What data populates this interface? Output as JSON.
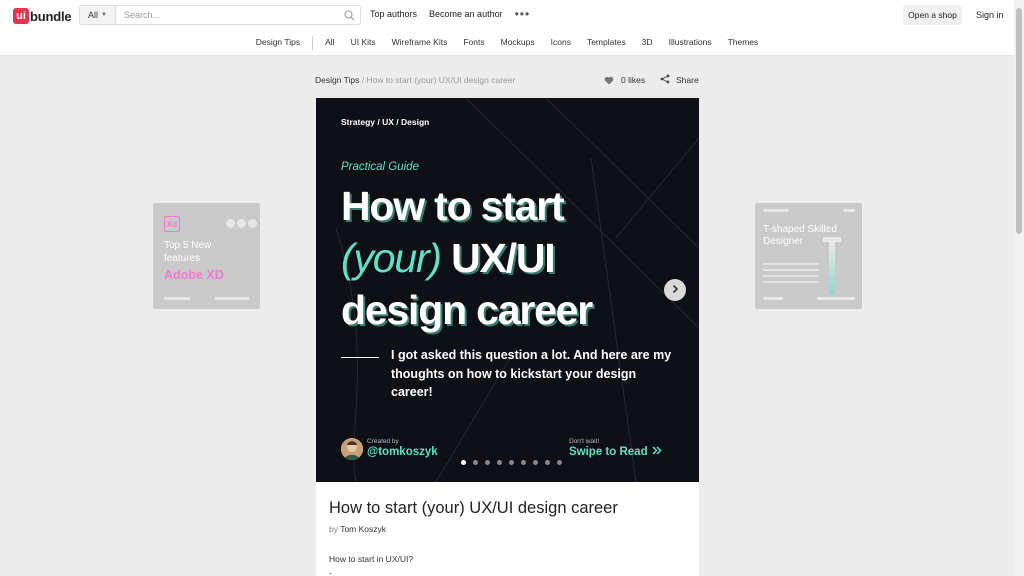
{
  "header": {
    "logo_mark": "ui",
    "logo_text": "bundle",
    "search": {
      "category": "All",
      "placeholder": "Search..."
    },
    "links": [
      "Top authors",
      "Become an author"
    ],
    "open_shop": "Open a shop",
    "sign_in": "Sign in"
  },
  "categories": {
    "first": "Design Tips",
    "items": [
      "All",
      "UI Kits",
      "Wireframe Kits",
      "Fonts",
      "Mockups",
      "Icons",
      "Templates",
      "3D",
      "Illustrations",
      "Themes"
    ]
  },
  "breadcrumb": {
    "parent": "Design Tips",
    "separator": " / ",
    "current": "How to start (your) UX/UI design career"
  },
  "actions": {
    "likes": "0 likes",
    "share": "Share"
  },
  "hero": {
    "tagline": "Strategy / UX / Design",
    "guide": "Practical Guide",
    "headline_line1": "How to start",
    "headline_accent": "(your)",
    "headline_line2_rest": " UX/UI",
    "headline_line3": "design career",
    "quote": "I got asked this question a lot. And here are my thoughts on how to kickstart your design career!",
    "created_by": "Created by",
    "handle": "@tomkoszyk",
    "dont_wait": "Don't wait!",
    "swipe": "Swipe to Read",
    "slide_count": 9,
    "active_slide": 1
  },
  "post": {
    "title": "How to start (your) UX/UI design career",
    "by_prefix": "by ",
    "author": "Tom Koszyk",
    "body": "How to start in UX/UI?",
    "body_line2": "-"
  },
  "side_left": {
    "badge": "Xd",
    "line1": "Top 5 New",
    "line2": "features",
    "line3": "Adobe XD"
  },
  "side_right": {
    "title": "T-shaped Skilled Designer"
  },
  "colors": {
    "brand": "#e8304f",
    "hero_bg": "#0f1016",
    "accent": "#5fe0c7",
    "xd_pink": "#f07bd4"
  }
}
